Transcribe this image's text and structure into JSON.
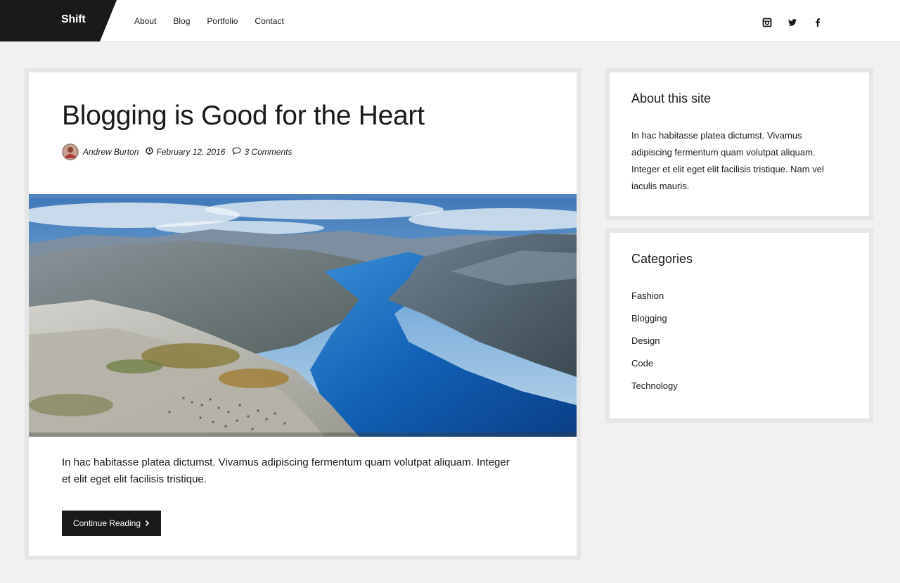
{
  "header": {
    "logo": "Shift",
    "nav": [
      "About",
      "Blog",
      "Portfolio",
      "Contact"
    ],
    "social": [
      "instagram-icon",
      "twitter-icon",
      "facebook-icon"
    ]
  },
  "post": {
    "title": "Blogging is Good for the Heart",
    "author": "Andrew Burton",
    "date": "February 12, 2016",
    "comments": "3 Comments",
    "excerpt": "In hac habitasse platea dictumst. Vivamus adipiscing fermentum quam volutpat aliquam. Integer et elit eget elit facilisis tristique.",
    "button": "Continue Reading"
  },
  "sidebar": {
    "about": {
      "title": "About this site",
      "text": "In hac habitasse platea dictumst. Vivamus adipiscing fermentum quam volutpat aliquam. Integer et elit eget elit facilisis tristique. Nam vel iaculis mauris."
    },
    "categories": {
      "title": "Categories",
      "items": [
        "Fashion",
        "Blogging",
        "Design",
        "Code",
        "Technology"
      ]
    }
  },
  "colors": {
    "accent": "#1a1a1a",
    "page_bg": "#f1f1f1",
    "card_border": "#e6e6e6"
  }
}
